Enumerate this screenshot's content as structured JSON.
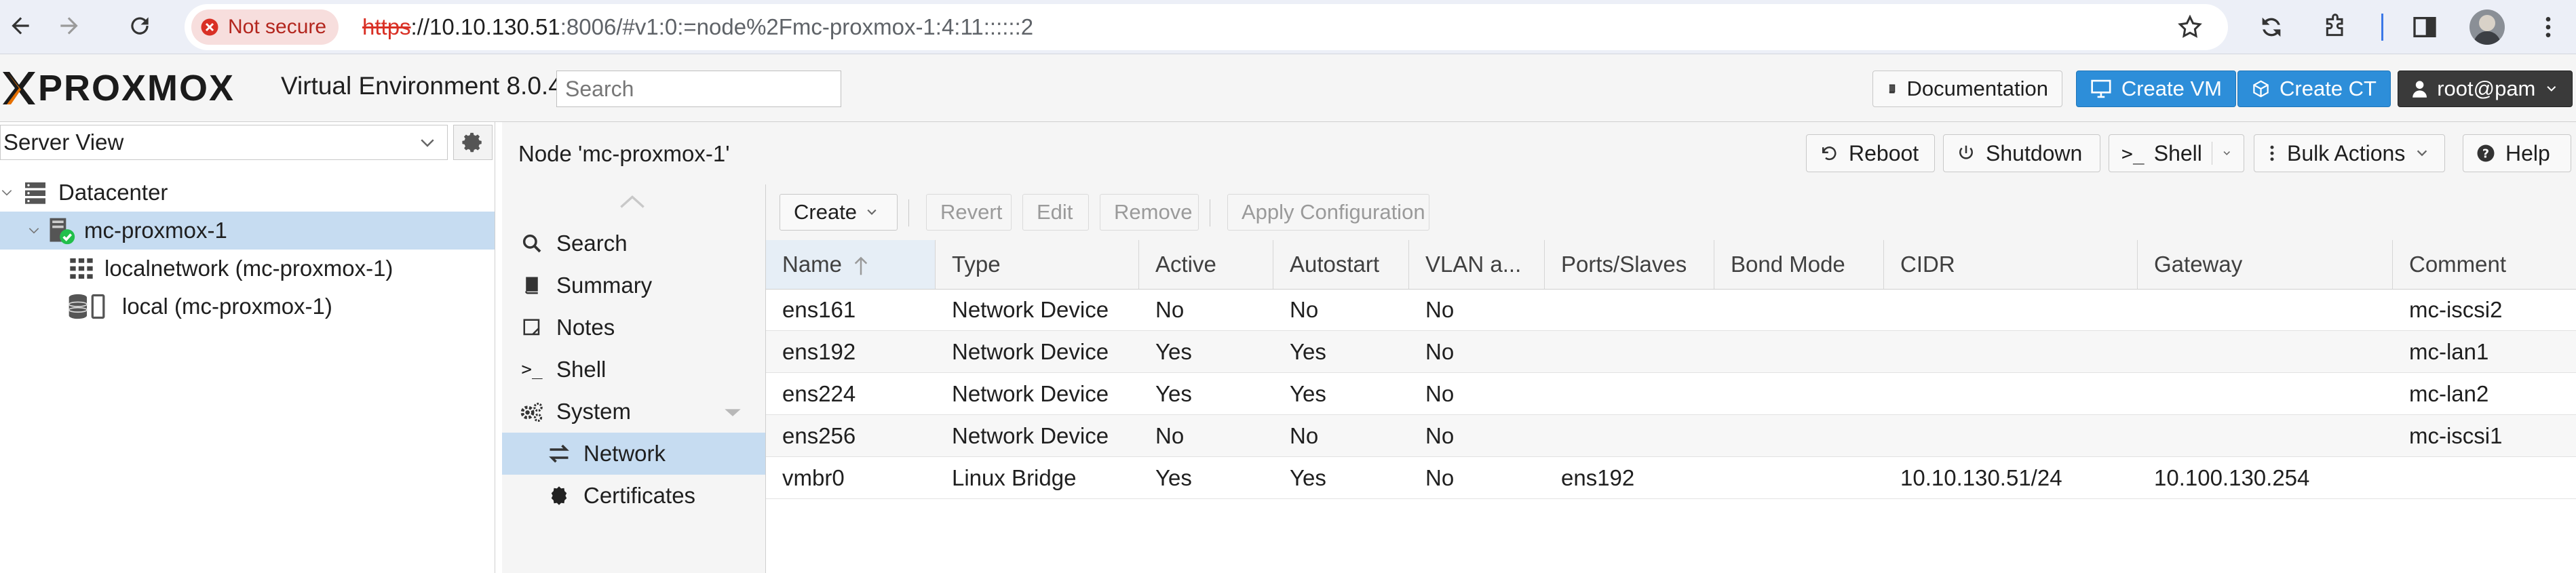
{
  "browser": {
    "security_label": "Not secure",
    "url_scheme": "https",
    "url_host": "://10.10.130.51",
    "url_rest": ":8006/#v1:0:=node%2Fmc-proxmox-1:4:11::::::2"
  },
  "header": {
    "logo_text": "PROXMOX",
    "product": "Virtual Environment 8.0.4",
    "search_placeholder": "Search",
    "documentation": "Documentation",
    "create_vm": "Create VM",
    "create_ct": "Create CT",
    "user": "root@pam"
  },
  "tree": {
    "view": "Server View",
    "items": [
      {
        "label": "Datacenter"
      },
      {
        "label": "mc-proxmox-1"
      },
      {
        "label": "localnetwork (mc-proxmox-1)"
      },
      {
        "label": "local (mc-proxmox-1)"
      }
    ]
  },
  "node": {
    "title": "Node 'mc-proxmox-1'",
    "reboot": "Reboot",
    "shutdown": "Shutdown",
    "shell": "Shell",
    "bulk_actions": "Bulk Actions",
    "help": "Help"
  },
  "nav": {
    "items": [
      {
        "label": "Search"
      },
      {
        "label": "Summary"
      },
      {
        "label": "Notes"
      },
      {
        "label": "Shell"
      },
      {
        "label": "System"
      },
      {
        "label": "Network"
      },
      {
        "label": "Certificates"
      }
    ]
  },
  "toolbar": {
    "create": "Create",
    "revert": "Revert",
    "edit": "Edit",
    "remove": "Remove",
    "apply": "Apply Configuration"
  },
  "grid": {
    "columns": [
      "Name",
      "Type",
      "Active",
      "Autostart",
      "VLAN a...",
      "Ports/Slaves",
      "Bond Mode",
      "CIDR",
      "Gateway",
      "Comment"
    ],
    "rows": [
      [
        "ens161",
        "Network Device",
        "No",
        "No",
        "No",
        "",
        "",
        "",
        "",
        "mc-iscsi2"
      ],
      [
        "ens192",
        "Network Device",
        "Yes",
        "Yes",
        "No",
        "",
        "",
        "",
        "",
        "mc-lan1"
      ],
      [
        "ens224",
        "Network Device",
        "Yes",
        "Yes",
        "No",
        "",
        "",
        "",
        "",
        "mc-lan2"
      ],
      [
        "ens256",
        "Network Device",
        "No",
        "No",
        "No",
        "",
        "",
        "",
        "",
        "mc-iscsi1"
      ],
      [
        "vmbr0",
        "Linux Bridge",
        "Yes",
        "Yes",
        "No",
        "ens192",
        "",
        "10.10.130.51/24",
        "10.100.130.254",
        ""
      ]
    ]
  },
  "colors": {
    "accent_blue": "#2d8ed9",
    "selection": "#c6dcf1",
    "proxmox_orange": "#e57000"
  }
}
